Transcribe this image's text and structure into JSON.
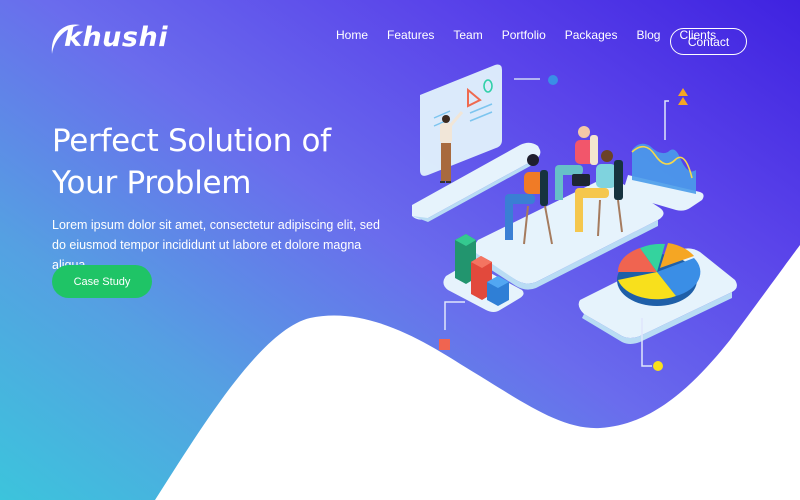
{
  "brand": {
    "name": "khushi"
  },
  "nav": {
    "items": [
      {
        "label": "Home"
      },
      {
        "label": "Features"
      },
      {
        "label": "Team"
      },
      {
        "label": "Portfolio"
      },
      {
        "label": "Packages"
      },
      {
        "label": "Blog"
      },
      {
        "label": "Clients"
      }
    ],
    "contact_label": "Contact"
  },
  "hero": {
    "title_line1": "Perfect Solution of",
    "title_line2": "Your Problem",
    "description": "Lorem ipsum dolor sit amet, consectetur adipiscing elit, sed do eiusmod tempor incididunt ut labore et dolore magna aliqua.",
    "cta_label": "Case Study"
  },
  "colors": {
    "gradient_top_right": "#3f22e0",
    "gradient_bottom_left": "#3cc4dc",
    "cta_green": "#1fc466",
    "accent_orange": "#f5a623",
    "accent_red": "#f06450",
    "accent_yellow": "#f8e01c",
    "accent_blue": "#3a8ee6"
  },
  "illustration": {
    "description": "isometric team meeting with presentation board, bar chart, pie chart and wave chart"
  }
}
